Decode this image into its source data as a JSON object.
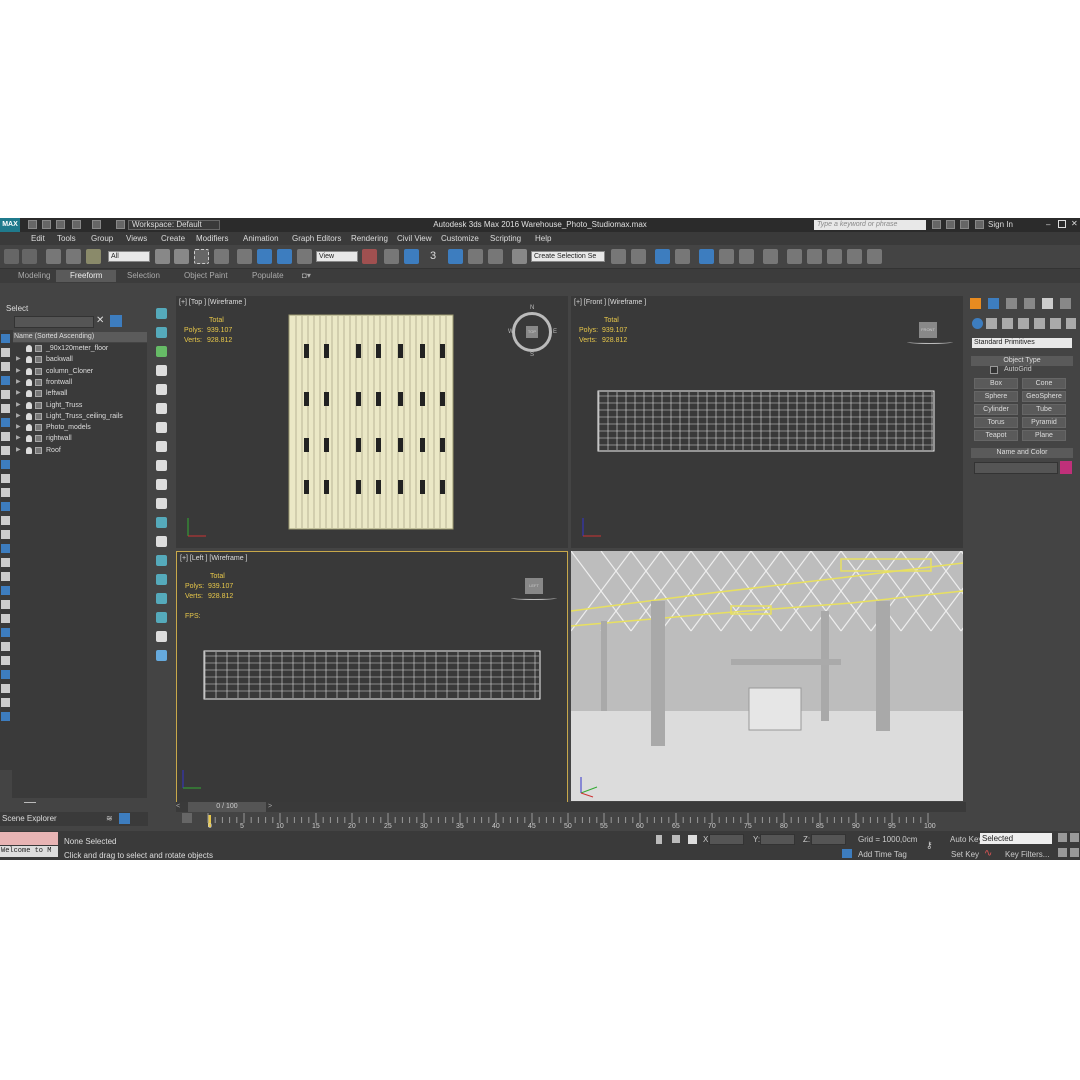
{
  "titlebar": {
    "logo": "MAX",
    "workspace": "Workspace: Default",
    "app_title": "Autodesk 3ds Max 2016     Warehouse_Photo_Studiomax.max",
    "search_placeholder": "Type a keyword or phrase",
    "signin": "Sign In"
  },
  "menu": [
    "Edit",
    "Tools",
    "Group",
    "Views",
    "Create",
    "Modifiers",
    "Animation",
    "Graph Editors",
    "Rendering",
    "Civil View",
    "Customize",
    "Scripting",
    "Help"
  ],
  "toolbar": {
    "filter": "All",
    "ref_coord": "View",
    "angle_snap": "3",
    "selection_set": "Create Selection Se"
  },
  "ribbon": [
    "Modeling",
    "Freeform",
    "Selection",
    "Object Paint",
    "Populate"
  ],
  "explorer": {
    "title": "Select",
    "column": "Name (Sorted Ascending)",
    "items": [
      "_90x120meter_floor",
      "backwall",
      "column_Cloner",
      "frontwall",
      "leftwall",
      "Light_Truss",
      "Light_Truss_ceiling_rails",
      "Photo_models",
      "rightwall",
      "Roof"
    ],
    "footer": "Scene Explorer"
  },
  "viewports": {
    "top": {
      "label": "[+] [Top ] [Wireframe ]"
    },
    "front": {
      "label": "[+] [Front ] [Wireframe ]"
    },
    "left": {
      "label": "[+] [Left ] [Wireframe ]"
    },
    "stats": {
      "total": "Total",
      "polys_label": "Polys:",
      "polys": "939.107",
      "verts_label": "Verts:",
      "verts": "928.812",
      "fps": "FPS:"
    },
    "cube_top": "TOP",
    "cube_front": "FRONT",
    "cube_left": "LEFT",
    "compass": {
      "n": "N",
      "s": "S",
      "w": "W",
      "e": "E"
    },
    "axis": {
      "x": "x",
      "y": "y",
      "z": "z"
    }
  },
  "command_panel": {
    "category": "Standard Primitives",
    "object_type": "Object Type",
    "autogrid": "AutoGrid",
    "buttons": [
      "Box",
      "Cone",
      "Sphere",
      "GeoSphere",
      "Cylinder",
      "Tube",
      "Torus",
      "Pyramid",
      "Teapot",
      "Plane"
    ],
    "name_color": "Name and Color",
    "swatch_color": "#c0307a"
  },
  "timeline": {
    "frame": "0 / 100",
    "ticks": [
      "0",
      "5",
      "10",
      "15",
      "20",
      "25",
      "30",
      "35",
      "40",
      "45",
      "50",
      "55",
      "60",
      "65",
      "70",
      "75",
      "80",
      "85",
      "90",
      "95",
      "100"
    ]
  },
  "status": {
    "selection": "None Selected",
    "prompt": "Click and drag to select and rotate objects",
    "welcome": "Welcome to M",
    "x_label": "X:",
    "y_label": "Y:",
    "z_label": "Z:",
    "grid": "Grid = 1000,0cm",
    "add_time_tag": "Add Time Tag",
    "auto_key": "Auto Key",
    "set_key": "Set Key",
    "key_mode": "Selected",
    "key_filters": "Key Filters..."
  }
}
